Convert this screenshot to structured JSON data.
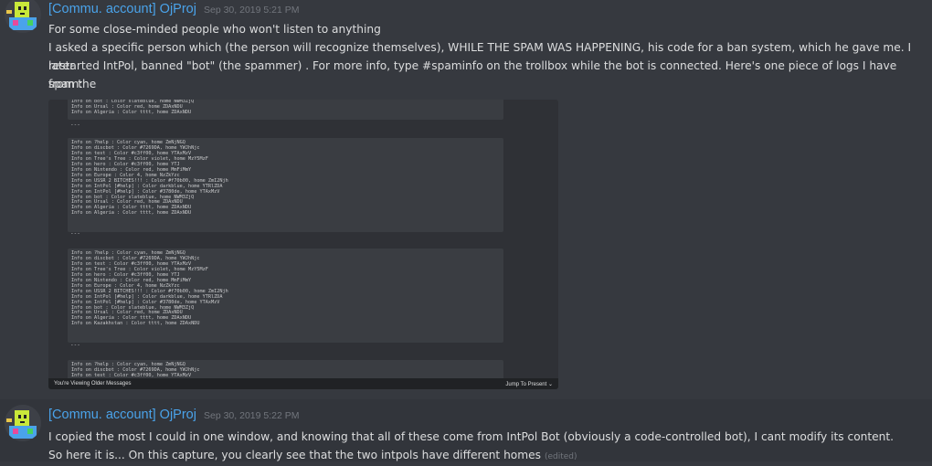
{
  "messages": [
    {
      "username": "[Commu. account] OjProj",
      "timestamp": "Sep 30, 2019 5:21 PM",
      "lines": [
        "For some close-minded people who won't listen to anything",
        "I asked a specific person which (the person will recognize themselves), WHILE THE SPAM WAS HAPPENING, his code for a ban system, which he gave me. I later",
        "restarted IntPol, banned \"bot\" (the spammer) . For more info, type #spaminfo on the trollbox while the bot is connected. Here's one piece of logs I have from the",
        "spam:"
      ]
    },
    {
      "username": "[Commu. account] OjProj",
      "timestamp": "Sep 30, 2019 5:22 PM",
      "lines": [
        "I copied the most I could in one window, and knowing that all of these come from IntPol Bot (obviously a code-controlled bot), I cant modify its content.",
        "So here it is... On this capture, you clearly see that the two intpols have different homes"
      ],
      "edited_label": "(edited)"
    }
  ],
  "attachment": {
    "blocks": [
      [
        "Info on bot :  Color slateblue, home NWM3ZjQ",
        "Info on Ursal :  Color red, home ZDAxNDU",
        "Info on Algeria :  Color tttt, home ZDAxNDU"
      ],
      [
        "Info on ?help :  Color cyan, home ZmNjNGQ",
        "Info on discbot :  Color #7269DA, home YWJhNjc",
        "Info on test :  Color #c3ff00, home YTAxMzV",
        "Info on Tree's Tree :  Color violet, home MzY5MzF",
        "Info on hero :  Color #c3ff00, home YTJ",
        "Info on Nintendo :  Color red, home MmFiMmY",
        "Info on Europe :  Color 4, home NzZkYzc",
        "Info on USSR 2 BITCHES!!! :  Color #f70b00, home ZmI2Njh",
        "Info on IntPol [#help] :  Color darkblue, home YTRlZDA",
        "Info on IntPol [#help] :  Color #3780de, home YTAxMzV",
        "Info on bot :  Color slateblue, home NWM3ZjQ",
        "Info on Ursal :  Color red, home ZDAxNDU",
        "Info on Algeria :  Color tttt, home ZDAxNDU",
        "Info on Algeria :  Color tttt, home ZDAxNDU"
      ],
      [
        "Info on ?help :  Color cyan, home ZmNjNGQ",
        "Info on discbot :  Color #7269DA, home YWJhNjc",
        "Info on test :  Color #c3ff00, home YTAxMzV",
        "Info on Tree's Tree :  Color violet, home MzY5MzF",
        "Info on hero :  Color #c3ff00, home YTJ",
        "Info on Nintendo :  Color red, home MmFiMmY",
        "Info on Europe :  Color 4, home NzZkYzc",
        "Info on USSR 2 BITCHES!!! :  Color #f70b00, home ZmI2Njh",
        "Info on IntPol [#help] :  Color darkblue, home YTRlZDA",
        "Info on IntPol [#help] :  Color #3780de, home YTAxMzV",
        "Info on bot :  Color slateblue, home NWM3ZjQ",
        "Info on Ursal :  Color red, home ZDAxNDU",
        "Info on Algeria :  Color tttt, home ZDAxNDU",
        "Info on Kazakhstan :  Color tttt, home ZDAxNDU"
      ],
      [
        "Info on ?help :  Color cyan, home ZmNjNGQ",
        "Info on discbot :  Color #7269DA, home YWJhNjc",
        "Info on test :  Color #c3ff00, home YTAxMzV"
      ]
    ],
    "separator": "---",
    "older_messages_label": "You're Viewing Older Messages",
    "jump_label": "Jump To Present"
  }
}
